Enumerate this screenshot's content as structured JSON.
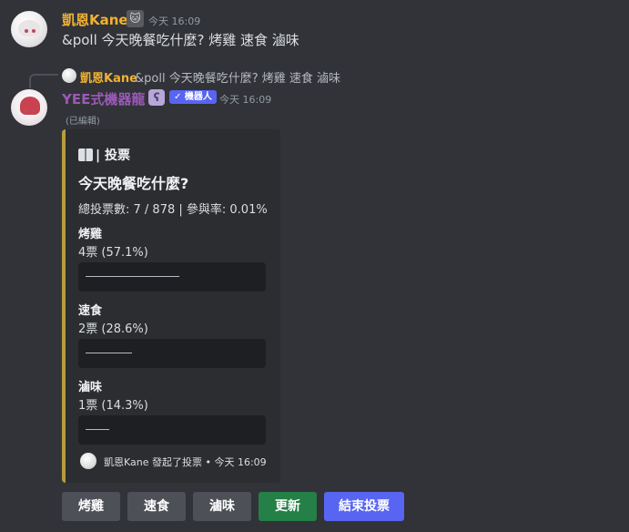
{
  "message1": {
    "username": "凱恩Kane",
    "badge_icon": "cat-icon",
    "timestamp": "今天 16:09",
    "text": "&poll 今天晚餐吃什麼? 烤雞 速食 滷味"
  },
  "reply": {
    "username": "凱恩Kane",
    "text": "&poll 今天晚餐吃什麼? 烤雞 速食 滷味"
  },
  "message2": {
    "username": "YEE式機器龍",
    "app_icon": "bot-app-icon",
    "bot_badge": "✓ 機器人",
    "timestamp": "今天 16:09",
    "edited": "(已編輯)"
  },
  "embed": {
    "accent_color": "#b89b3c",
    "author": "投票",
    "author_icon": "book-icon",
    "title": "今天晚餐吃什麼?",
    "description": "總投票數: 7 / 878 | 參與率: 0.01%",
    "options": [
      {
        "name": "烤雞",
        "result": "4票 (57.1%)",
        "fraction": 0.571
      },
      {
        "name": "速食",
        "result": "2票 (28.6%)",
        "fraction": 0.286
      },
      {
        "name": "滷味",
        "result": "1票 (14.3%)",
        "fraction": 0.143
      }
    ],
    "footer": "凱恩Kane 發起了投票 • 今天 16:09"
  },
  "buttons": [
    {
      "label": "烤雞",
      "style": "secondary"
    },
    {
      "label": "速食",
      "style": "secondary"
    },
    {
      "label": "滷味",
      "style": "secondary"
    },
    {
      "label": "更新",
      "style": "success"
    },
    {
      "label": "結束投票",
      "style": "primary"
    }
  ]
}
